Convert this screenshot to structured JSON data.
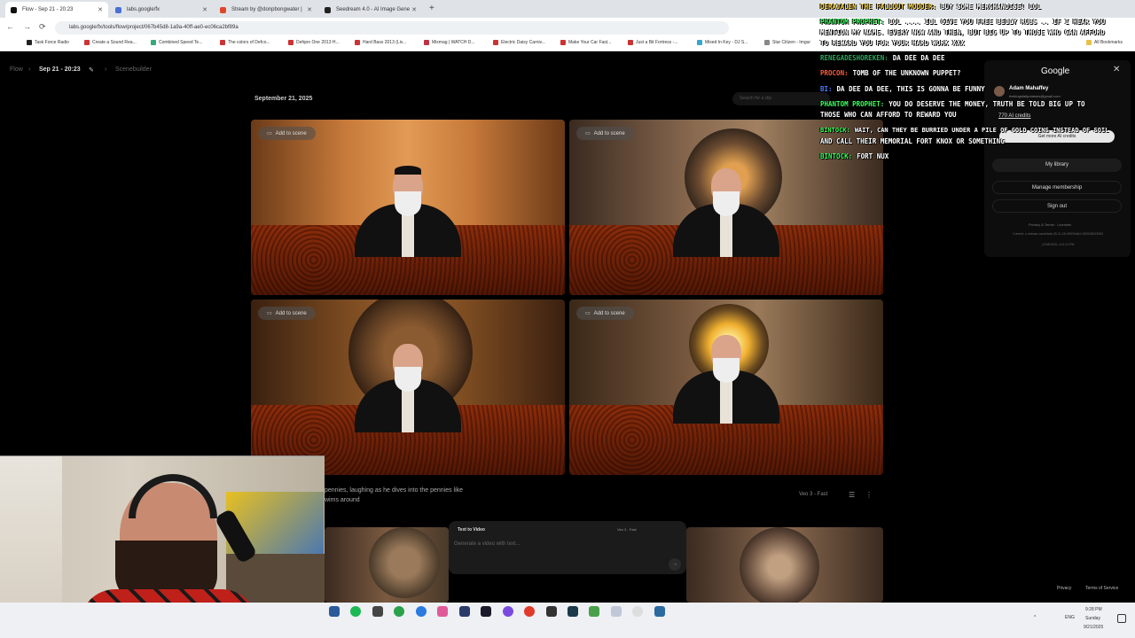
{
  "tabs": [
    {
      "label": "Flow - Sep 21 - 20:23",
      "color": "#111111"
    },
    {
      "label": "labs.google/fx",
      "color": "#4a6fd6"
    },
    {
      "label": "Stream by @donpbongwater |",
      "color": "#e0452b"
    },
    {
      "label": "Seedream 4.0 - AI Image Gene",
      "color": "#222222"
    }
  ],
  "new_tab": "+",
  "address": {
    "url": "labs.google/fx/tools/flow/project/067b45d8-1a9a-40ff-ae0-ec06ca2bf89a"
  },
  "nav": {
    "back": "←",
    "forward": "→",
    "reload": "⟳"
  },
  "bookmarks": [
    {
      "label": "Task Force Radio"
    },
    {
      "label": "Create a Sound Rea..."
    },
    {
      "label": "Combined Speed Te..."
    },
    {
      "label": "The colors of Defco..."
    },
    {
      "label": "Defqon One 2013 H..."
    },
    {
      "label": "Hard Bass 2013 (Liv..."
    },
    {
      "label": "Mixmag | WATCH D..."
    },
    {
      "label": "Electric Daisy Carniv..."
    },
    {
      "label": "Make Your Car Fast..."
    },
    {
      "label": "Just a Bit Fortress -..."
    },
    {
      "label": "Mixed In Key - DJ S..."
    },
    {
      "label": "Star Citizen - Imgur"
    }
  ],
  "all_bookmarks": "All Bookmarks",
  "breadcrumb": {
    "root": "Flow",
    "project": "Sep 21 - 20:23",
    "edit_icon": "✎",
    "section": "Scenebuilder"
  },
  "main": {
    "date": "September 21, 2025",
    "search_placeholder": "Search for a clip",
    "add_to_scene": "Add to scene",
    "prompt_text": "pennies, laughing as he dives into the pennies like\nwims around",
    "model": "Veo 3 - Fast",
    "more_icon": "⋮",
    "filter_icon": "☰"
  },
  "composer": {
    "mode": "Text to Video",
    "model": "Veo 3 - Fast",
    "placeholder": "Generate a video with text...",
    "send": "→"
  },
  "footer": {
    "privacy": "Privacy",
    "terms": "Terms of Service"
  },
  "chat": [
    {
      "user": "Derajalen The Fallout Modder:",
      "color": "#ffd84a",
      "text": "Buy some merchandise! LOL"
    },
    {
      "user": "PhanTom Prophet:",
      "color": "#39ff5a",
      "text": "LOL .... ill give you free belly rubs .. if i hear you"
    },
    {
      "user": "",
      "color": "#ffffff",
      "text": "mention my name. every now and then, but big up to those who can afford"
    },
    {
      "user": "",
      "color": "#ffffff",
      "text": "to reward you for your hard work XXX"
    },
    {
      "user": "RenegadeShoreKen:",
      "color": "#2ea35a",
      "text": "Da dee da dee"
    },
    {
      "user": "Procon:",
      "color": "#ff5a3c",
      "text": "Tomb of the unknown puppet?"
    },
    {
      "user": "Bi:",
      "color": "#4a7aff",
      "text": "Da dee da dee, this is gonna be funny"
    },
    {
      "user": "PhanTom Prophet:",
      "color": "#39ff5a",
      "text": "you do deserve the money, truth be told big up to"
    },
    {
      "user": "",
      "color": "#ffffff",
      "text": "those who can afford to reward you"
    },
    {
      "user": "Bintock:",
      "color": "#39ff5a",
      "text": "Wait, can they be burried under a pile of gold coins instead of Soil"
    },
    {
      "user": "",
      "color": "#ffffff",
      "text": "and call their memorial Fort Knox or something"
    },
    {
      "user": "Bintock:",
      "color": "#39ff5a",
      "text": "Fort Nux"
    }
  ],
  "account": {
    "brand": "Google",
    "close": "✕",
    "name": "Adam Mahaffey",
    "email": "thekingsfallpotatoes@gmail.com",
    "credits": "770 AI credits",
    "get_more": "Get more AI credits",
    "library": "My library",
    "manage": "Manage membership",
    "sign_out": "Sign out",
    "privacy": "Privacy & Terms   ·   Licenses",
    "commit": "Commit: v-release-candidate-09-11-25-9997eb4bf-250918203053",
    "stamp": "| 9/18/2025, 4:11:11 PM"
  },
  "taskbar": {
    "lang": "ENG",
    "time": "9:28 PM",
    "day": "Sunday",
    "date": "9/21/2025",
    "up": "^"
  }
}
